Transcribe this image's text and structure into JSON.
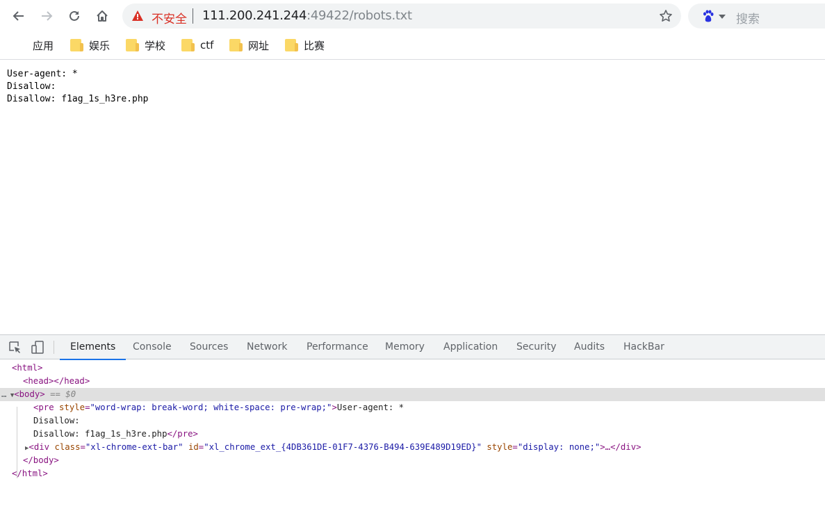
{
  "toolbar": {
    "insecure_label": "不安全",
    "url_host": "111.200.241.244",
    "url_rest": ":49422/robots.txt",
    "search_placeholder": "搜索"
  },
  "bookmarks": [
    {
      "label": "应用",
      "icon": "apps-grid-icon"
    },
    {
      "label": "娱乐",
      "icon": "folder-icon"
    },
    {
      "label": "学校",
      "icon": "folder-icon"
    },
    {
      "label": "ctf",
      "icon": "folder-icon"
    },
    {
      "label": "网址",
      "icon": "folder-icon"
    },
    {
      "label": "比赛",
      "icon": "folder-icon"
    }
  ],
  "page": {
    "robots_text": "User-agent: *\nDisallow:\nDisallow: f1ag_1s_h3re.php"
  },
  "devtools": {
    "tabs": [
      "Elements",
      "Console",
      "Sources",
      "Network",
      "Performance",
      "Memory",
      "Application",
      "Security",
      "Audits",
      "HackBar"
    ],
    "active_tab": "Elements",
    "dom": {
      "html_open": "<html>",
      "head": "<head></head>",
      "body_open": "<body>",
      "body_marker": "== $0",
      "pre_tag_open": "<pre",
      "pre_attr_name": "style",
      "pre_attr_value": "\"word-wrap: break-word; white-space: pre-wrap;\"",
      "pre_text_1": "User-agent: *",
      "pre_text_2": "Disallow:",
      "pre_text_3": "Disallow: f1ag_1s_h3re.php",
      "pre_close": "</pre>",
      "div_tag_open": "<div",
      "div_class_name": "class",
      "div_class_value": "\"xl-chrome-ext-bar\"",
      "div_id_name": "id",
      "div_id_value": "\"xl_chrome_ext_{4DB361DE-01F7-4376-B494-639E489D19ED}\"",
      "div_style_name": "style",
      "div_style_value": "\"display: none;\"",
      "div_rest": ">…</div>",
      "body_close": "</body>",
      "html_close": "</html>"
    }
  },
  "colors": {
    "insecure": "#d93025",
    "folder": "#fbd866",
    "active_tab_underline": "#1a73e8",
    "dom_tag": "#881280",
    "dom_attr": "#994500",
    "dom_value": "#1a1aa6"
  }
}
